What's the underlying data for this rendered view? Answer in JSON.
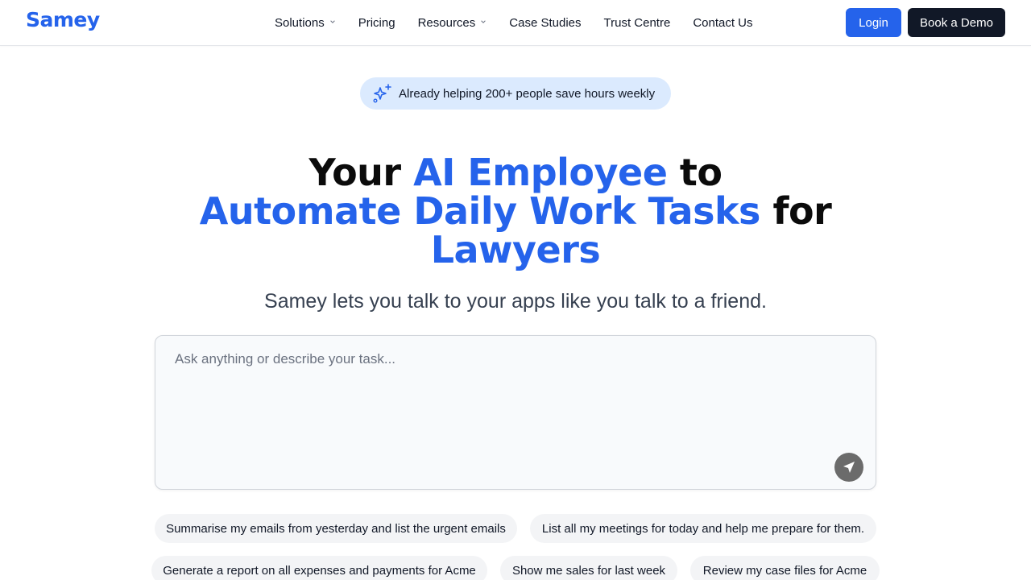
{
  "nav": {
    "logo": "Samey",
    "links": [
      {
        "label": "Solutions",
        "dropdown": true
      },
      {
        "label": "Pricing",
        "dropdown": false
      },
      {
        "label": "Resources",
        "dropdown": true
      },
      {
        "label": "Case Studies",
        "dropdown": false
      },
      {
        "label": "Trust Centre",
        "dropdown": false
      },
      {
        "label": "Contact Us",
        "dropdown": false
      }
    ],
    "login_label": "Login",
    "demo_label": "Book a Demo"
  },
  "badge": {
    "icon": "sparkles-icon",
    "text": "Already helping 200+ people save hours weekly"
  },
  "hero": {
    "line1_a": "Your ",
    "line1_b": "AI Employee",
    "line1_c": " to",
    "line2_a": "Automate Daily Work Tasks",
    "line2_b": " for",
    "line3": "Lawyers",
    "subtitle": "Samey lets you talk to your apps like you talk to a friend."
  },
  "prompt": {
    "placeholder": "Ask anything or describe your task...",
    "value": "",
    "send_icon": "send-icon"
  },
  "suggestions": [
    "Summarise my emails from yesterday and list the urgent emails",
    "List all my meetings for today and help me prepare for them.",
    "Generate a report on all expenses and payments for Acme",
    "Show me sales for last week",
    "Review my case files for Acme"
  ],
  "colors": {
    "accent": "#2563eb",
    "dark": "#111827",
    "badge_bg": "#dbeafe",
    "chip_bg": "#f3f4f6"
  }
}
